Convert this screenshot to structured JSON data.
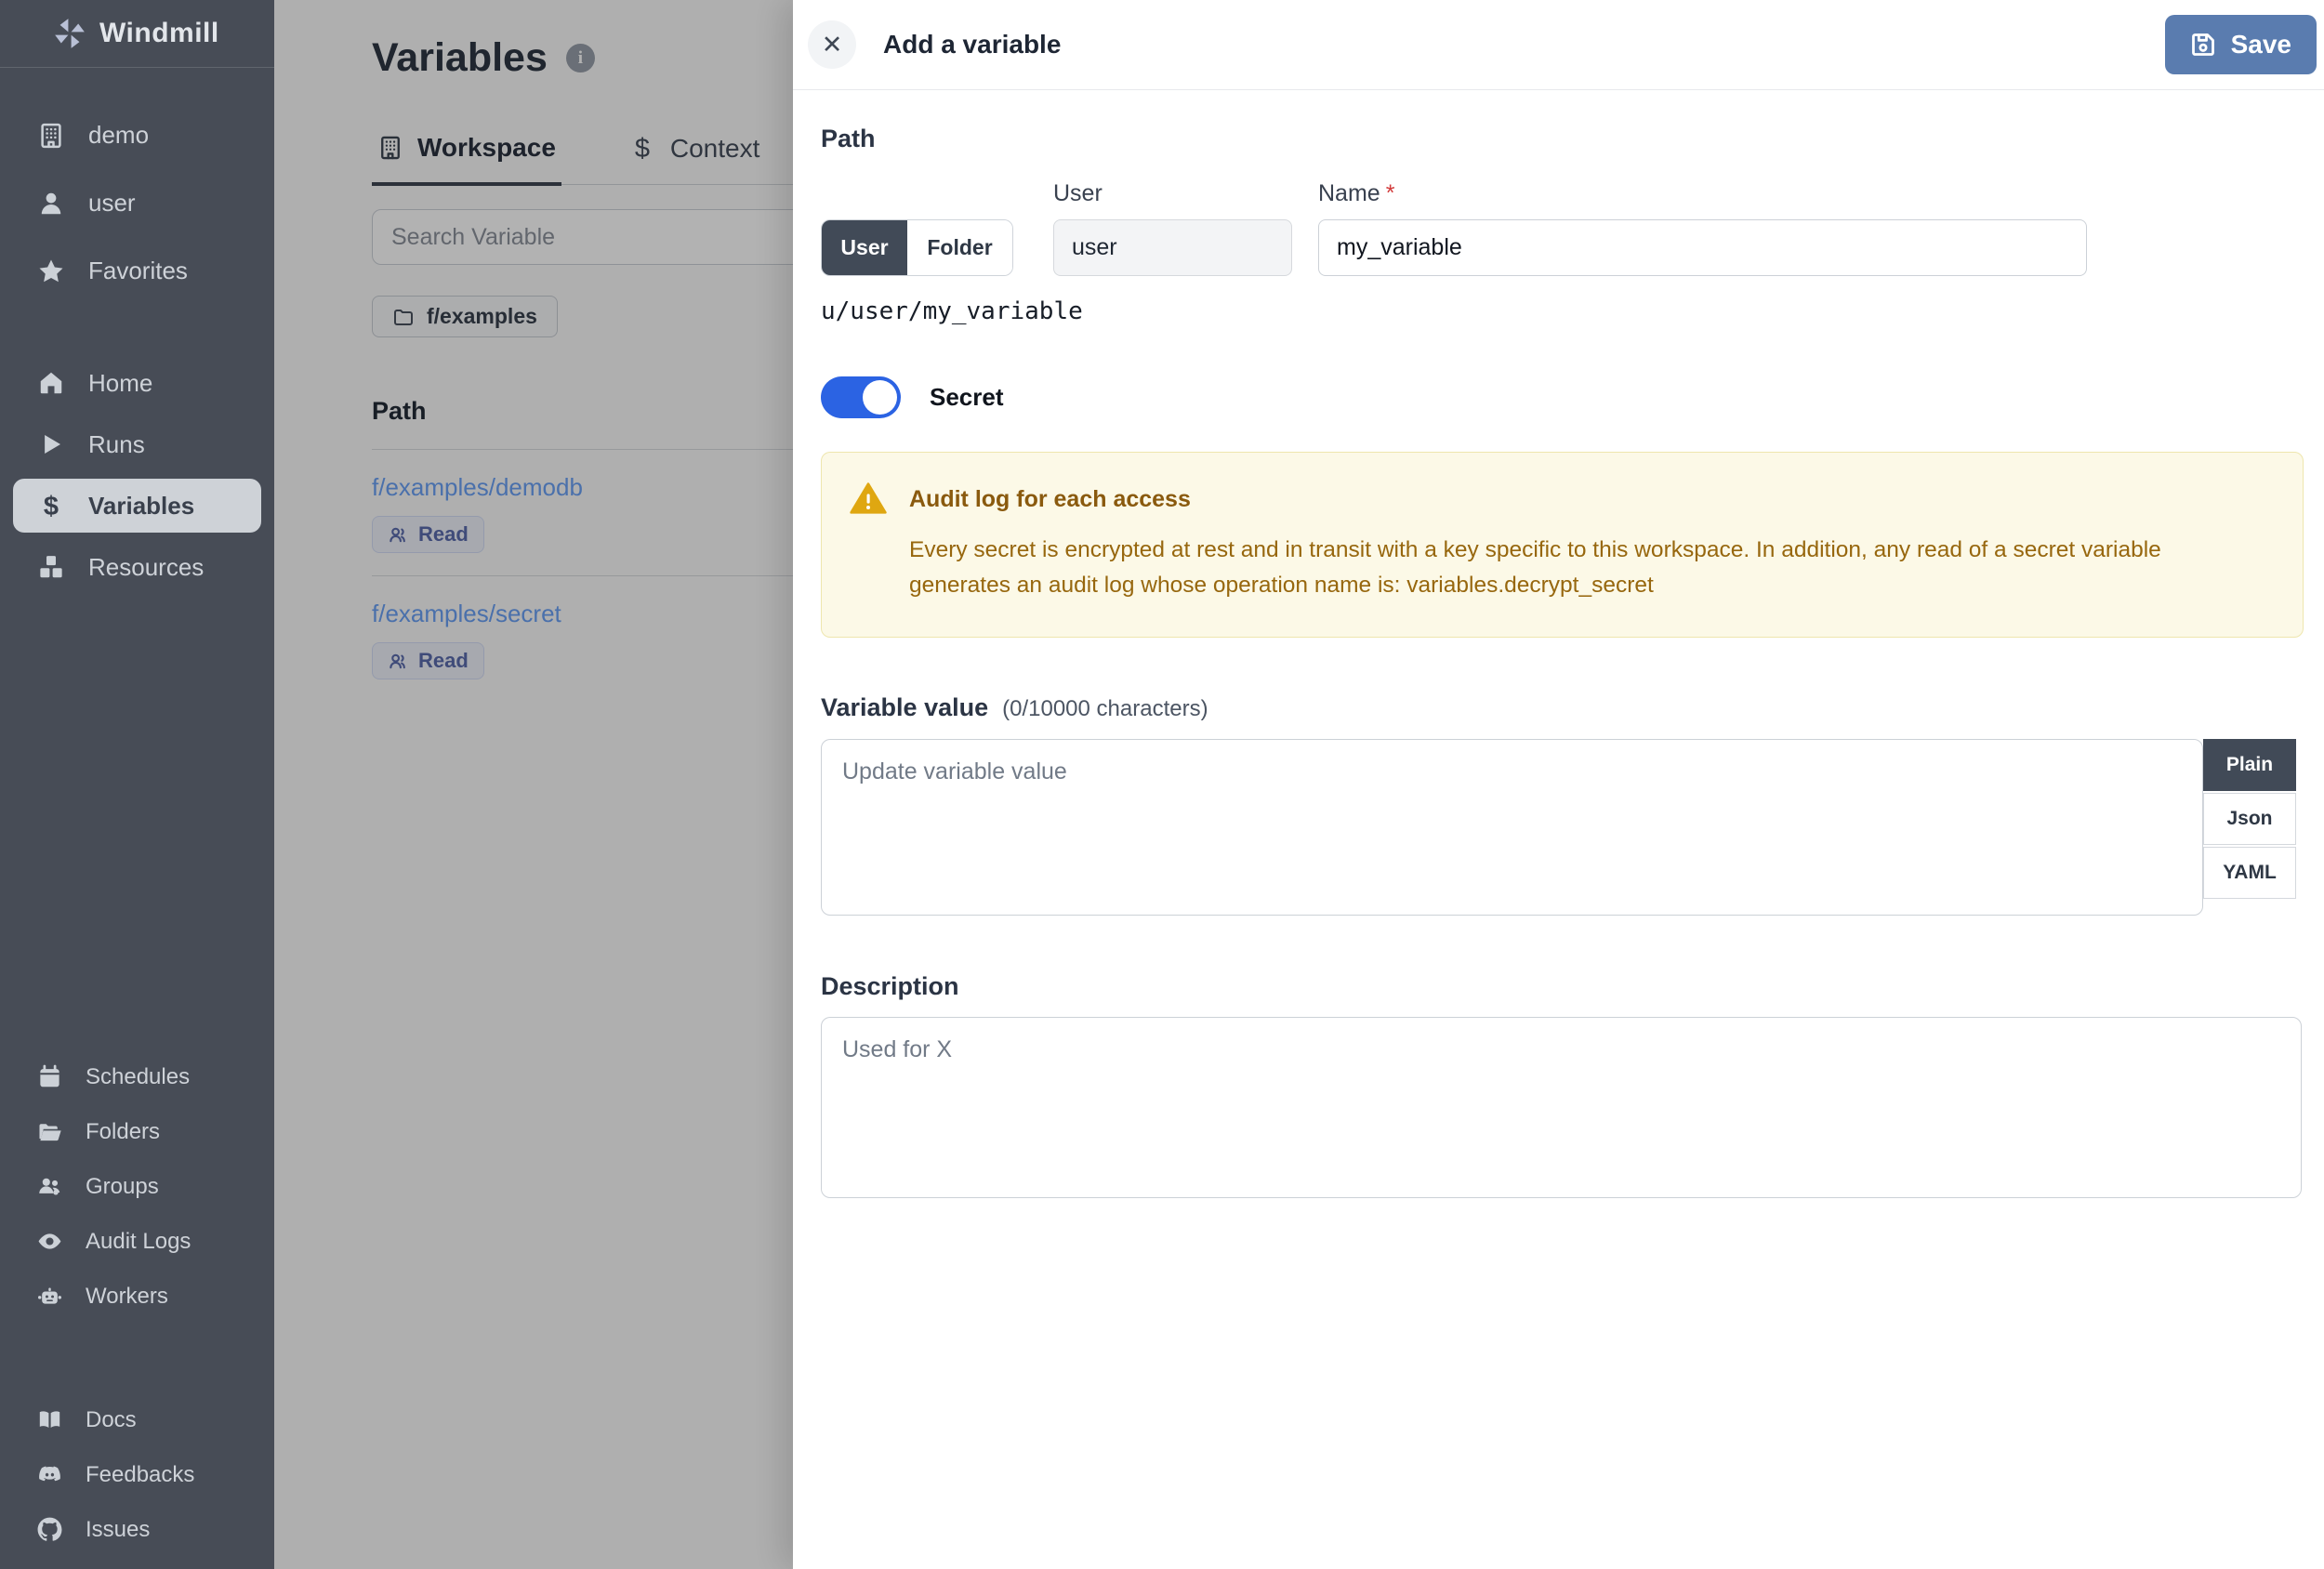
{
  "sidebar": {
    "brand": "Windmill",
    "workspace_items": [
      {
        "label": "demo"
      },
      {
        "label": "user"
      },
      {
        "label": "Favorites"
      }
    ],
    "nav_items": [
      {
        "label": "Home"
      },
      {
        "label": "Runs"
      },
      {
        "label": "Variables",
        "active": true
      },
      {
        "label": "Resources"
      }
    ],
    "admin_items": [
      {
        "label": "Schedules"
      },
      {
        "label": "Folders"
      },
      {
        "label": "Groups"
      },
      {
        "label": "Audit Logs"
      },
      {
        "label": "Workers"
      }
    ],
    "footer_items": [
      {
        "label": "Docs"
      },
      {
        "label": "Feedbacks"
      },
      {
        "label": "Issues"
      }
    ]
  },
  "content": {
    "title": "Variables",
    "tabs": [
      {
        "label": "Workspace",
        "active": true
      },
      {
        "label": "Context"
      }
    ],
    "search_placeholder": "Search Variable",
    "folder_chip": "f/examples",
    "table": {
      "path_header": "Path",
      "rows": [
        {
          "path": "f/examples/demodb",
          "badge": "Read"
        },
        {
          "path": "f/examples/secret",
          "badge": "Read"
        }
      ]
    }
  },
  "drawer": {
    "title": "Add a variable",
    "save_label": "Save",
    "path_section": {
      "heading": "Path",
      "owner_segments": [
        "User",
        "Folder"
      ],
      "owner_selected": "User",
      "user_label": "User",
      "user_value": "user",
      "name_label": "Name",
      "required_mark": "*",
      "name_value": "my_variable",
      "full_path": "u/user/my_variable"
    },
    "secret_toggle": {
      "label": "Secret",
      "state": "on"
    },
    "warning": {
      "title": "Audit log for each access",
      "body": "Every secret is encrypted at rest and in transit with a key specific to this workspace. In addition, any read of a secret variable generates an audit log whose operation name is: variables.decrypt_secret"
    },
    "value_section": {
      "heading": "Variable value",
      "counter": "(0/10000 characters)",
      "placeholder": "Update variable value",
      "formats": [
        "Plain",
        "Json",
        "YAML"
      ],
      "format_selected": "Plain"
    },
    "description_section": {
      "heading": "Description",
      "placeholder": "Used for X"
    }
  },
  "icons": {
    "dollar": "$",
    "info": "i",
    "close": "✕"
  },
  "colors": {
    "sidebar_bg": "#474c56",
    "active_dark": "#414a57",
    "save_button": "#5a7caf",
    "toggle_on": "#2b63e3",
    "link": "#6ba1f5",
    "warning_bg": "#fcf9e7",
    "warning_text": "#97670e"
  }
}
